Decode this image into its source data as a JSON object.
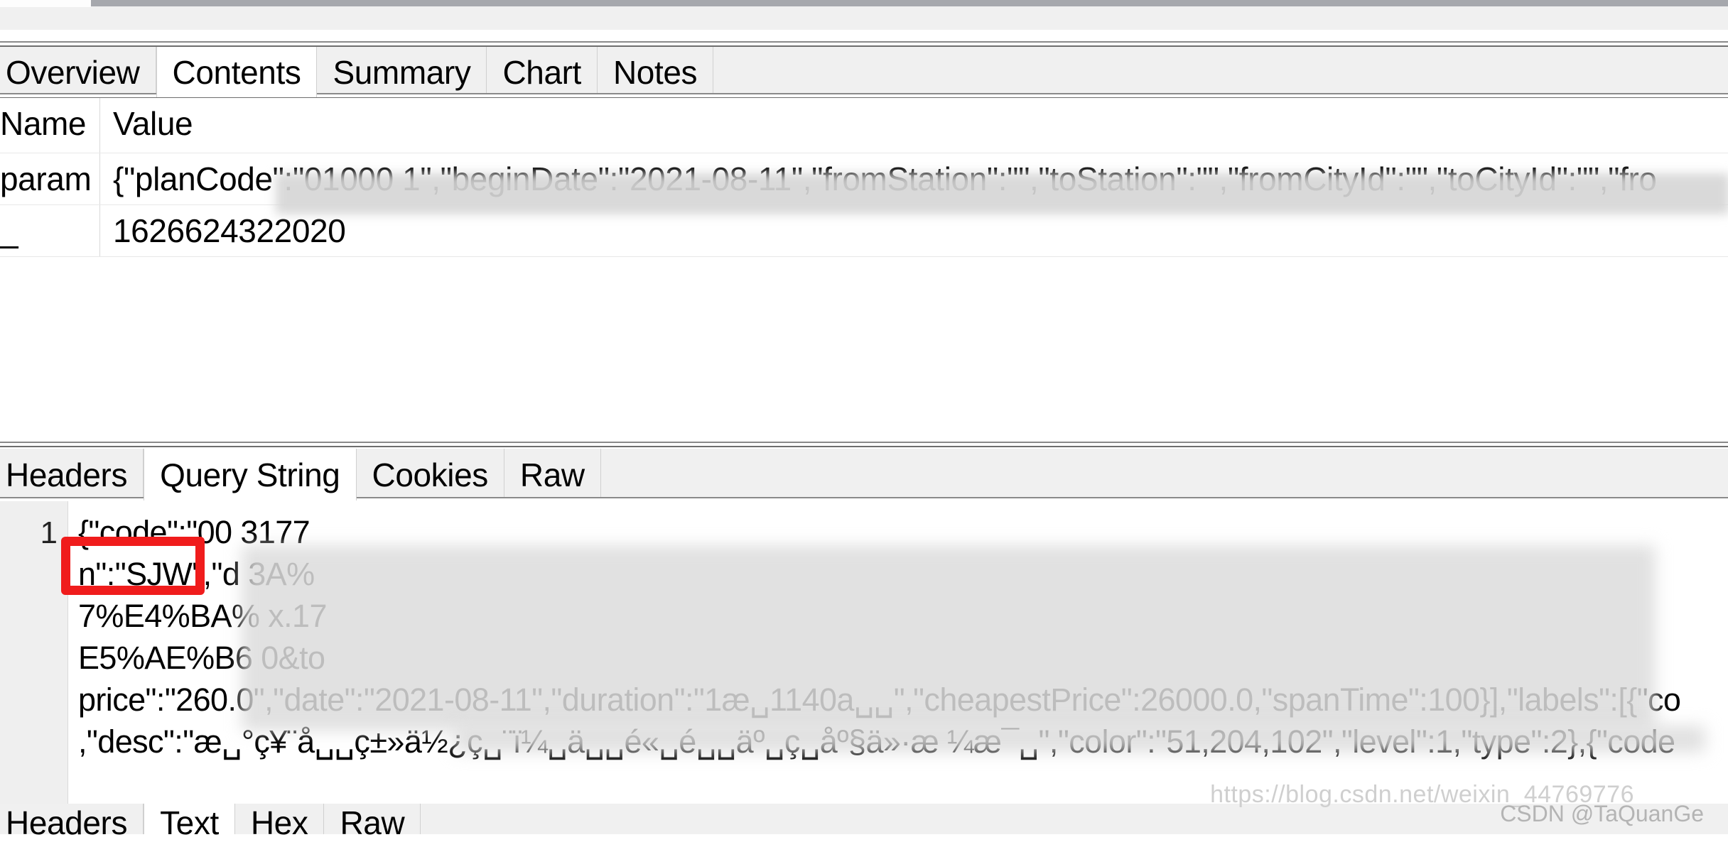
{
  "session_tabs": {
    "items": [
      {
        "label": "Overview",
        "selected": false
      },
      {
        "label": "Contents",
        "selected": true
      },
      {
        "label": "Summary",
        "selected": false
      },
      {
        "label": "Chart",
        "selected": false
      },
      {
        "label": "Notes",
        "selected": false
      }
    ]
  },
  "grid": {
    "columns": [
      "Name",
      "Value"
    ],
    "rows": [
      {
        "name": "param",
        "value": "{\"planCode\":\"01000 1\",\"beginDate\":\"2021-08-11\",\"fromStation\":\"\",\"toStation\":\"\",\"fromCityId\":\"\",\"toCityId\":\"\",\"fro"
      },
      {
        "name": "_",
        "value": "1626624322020"
      }
    ]
  },
  "request_tabs": {
    "items": [
      {
        "label": "Headers",
        "selected": false
      },
      {
        "label": "Query String",
        "selected": true
      },
      {
        "label": "Cookies",
        "selected": false
      },
      {
        "label": "Raw",
        "selected": false
      }
    ]
  },
  "response_tabs": {
    "items": [
      {
        "label": "Headers",
        "selected": false
      },
      {
        "label": "Text",
        "selected": true
      },
      {
        "label": "Hex",
        "selected": false
      },
      {
        "label": "Raw",
        "selected": false
      }
    ]
  },
  "body_viewer": {
    "line_number": "1",
    "lines": [
      "{\"code\":\"00                                                                                                                                     3177",
      "n\":\"SJW\",\"d                                                                                                                                 3A%",
      "7%E4%BA%                                                                                                                                     x.17",
      "E5%AE%B6                                                                                                                                     0&to",
      "price\":\"260.0\",\"date\":\"2021-08-11\",\"duration\":\"1æ␣1140a␣␣\",\"cheapestPrice\":26000.0,\"spanTime\":100}],\"labels\":[{\"co",
      ",\"desc\":\"æ␣°ç¥¨å␣␣ç±»ä½¿ç␣¨ï¼␣ä␣␣é«␣é␣␣äº␣ç­␣åº§ä»·æ ¼æ¯␣\",\"color\":\"51,204,102\",\"level\":1,\"type\":2},{\"code"
    ]
  },
  "watermark": {
    "url": "https://blog.csdn.net/weixin_44769776",
    "author": "CSDN @TaQuanGe"
  },
  "colors": {
    "accent_red": "#f01c1c",
    "chrome_gray": "#f0f0f0",
    "gutter_gray": "#efefef"
  }
}
